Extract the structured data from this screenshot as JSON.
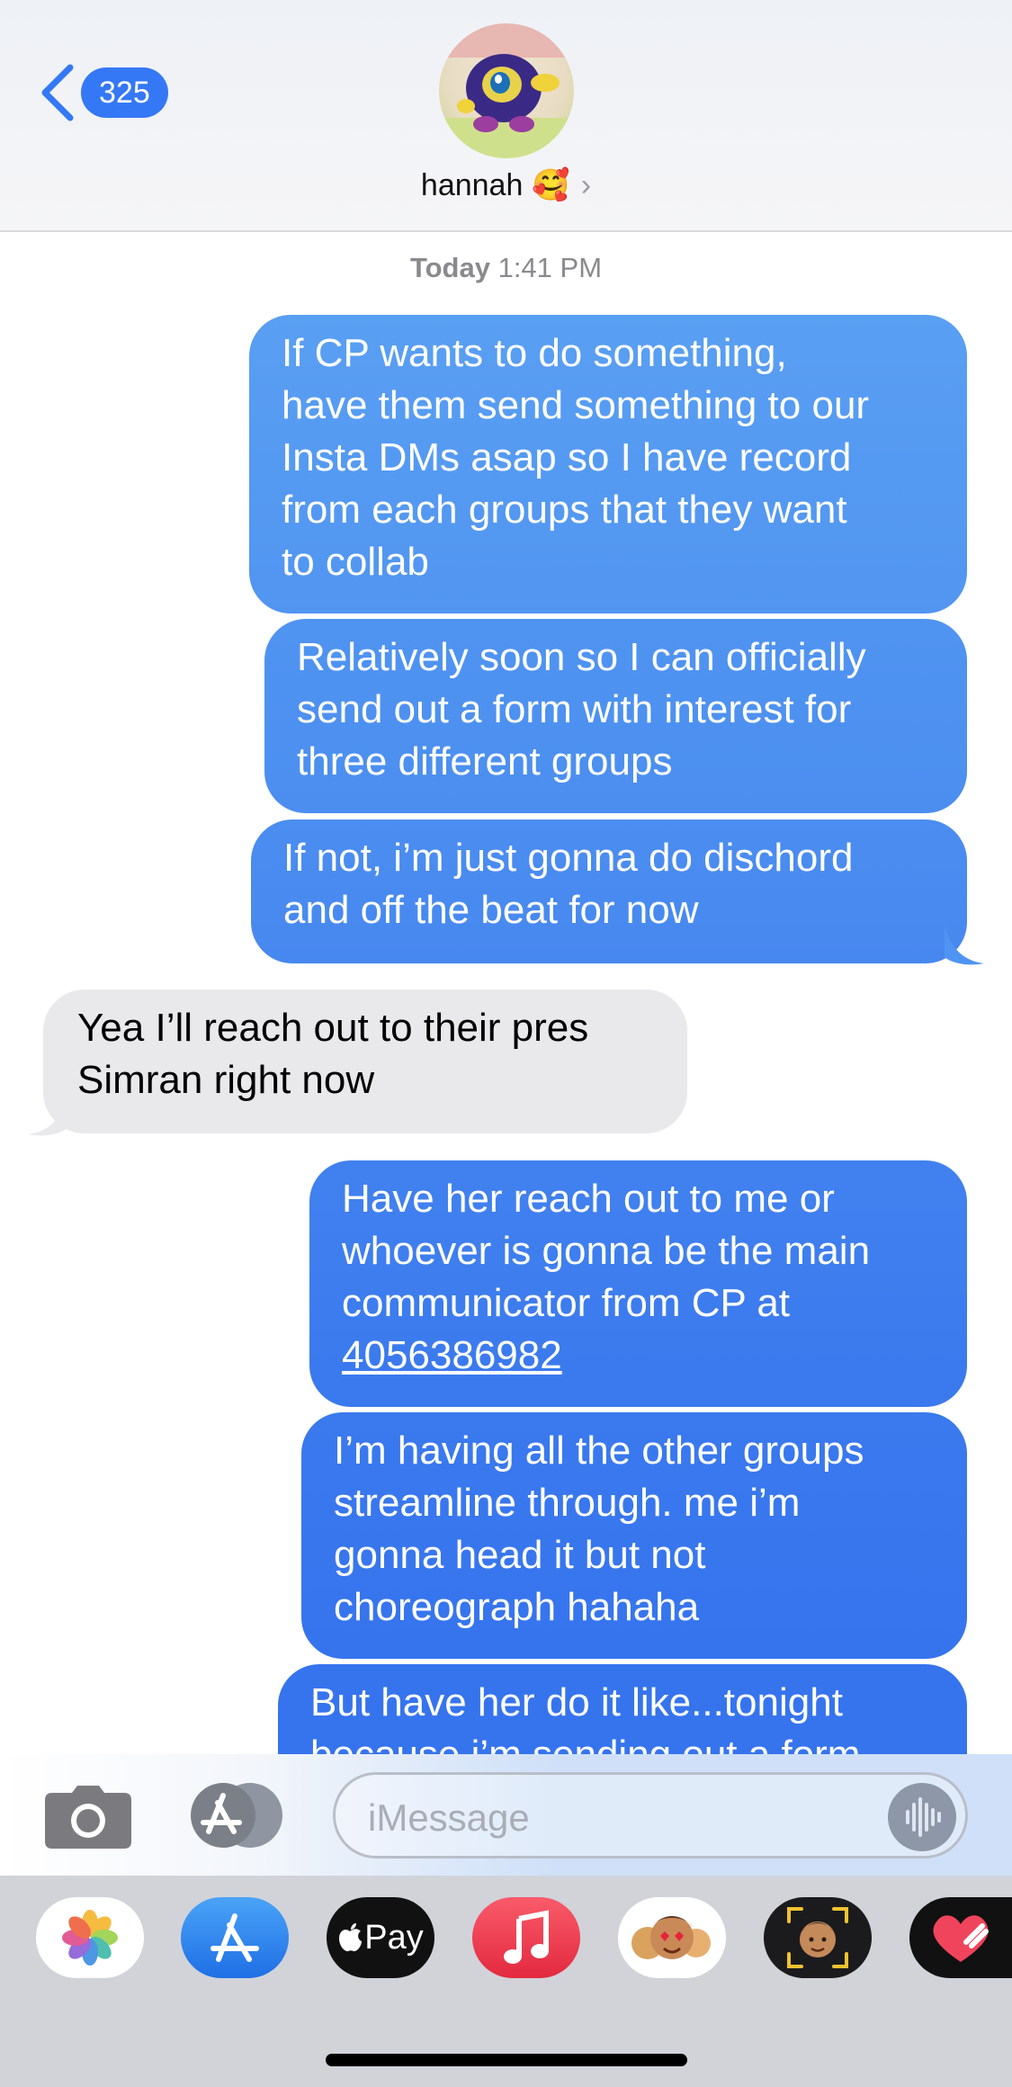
{
  "header": {
    "back_count": "325",
    "contact_name": "hannah",
    "contact_emoji": "🥰",
    "chevron": "›"
  },
  "timestamp": {
    "day": "Today",
    "time": "1:41 PM"
  },
  "messages": [
    {
      "sender": "me",
      "lines": [
        "If CP wants to do something,",
        "have them send something to our",
        "Insta DMs asap so I have record",
        "from each groups that they want",
        "to collab"
      ]
    },
    {
      "sender": "me",
      "lines": [
        "Relatively soon so I can officially",
        "send out a form with interest for",
        "three different groups"
      ]
    },
    {
      "sender": "me",
      "lines": [
        "If not, i’m just gonna do dischord",
        "and off the beat for now"
      ]
    },
    {
      "sender": "them",
      "lines": [
        "Yea I’ll reach out to their pres",
        "Simran right now"
      ]
    },
    {
      "sender": "me",
      "lines": [
        "Have her reach out to me or",
        "whoever is gonna be the main",
        "communicator from CP at",
        "4056386982"
      ]
    },
    {
      "sender": "me",
      "lines": [
        "I’m having all the other groups",
        "streamline through. me i’m",
        "gonna head it but not",
        "choreograph hahaha"
      ]
    },
    {
      "sender": "me",
      "lines": [
        "But have her do it like...tonight",
        "because i’m sending out a form"
      ]
    }
  ],
  "input": {
    "placeholder": "iMessage"
  },
  "colors": {
    "sent_top": "#62aaf3",
    "sent_bottom": "#3674ee",
    "received": "#e9e9eb",
    "accent": "#3478f6"
  },
  "icons": {
    "back": "chevron-left-icon",
    "camera": "camera-icon",
    "apps": "app-store-icon",
    "audio": "waveform-icon"
  },
  "app_drawer": [
    {
      "name": "Photos"
    },
    {
      "name": "App Store"
    },
    {
      "name": "Apple Pay",
      "label": "Pay"
    },
    {
      "name": "Music"
    },
    {
      "name": "Memoji Stickers"
    },
    {
      "name": "Animoji"
    },
    {
      "name": "Digital Touch"
    }
  ]
}
